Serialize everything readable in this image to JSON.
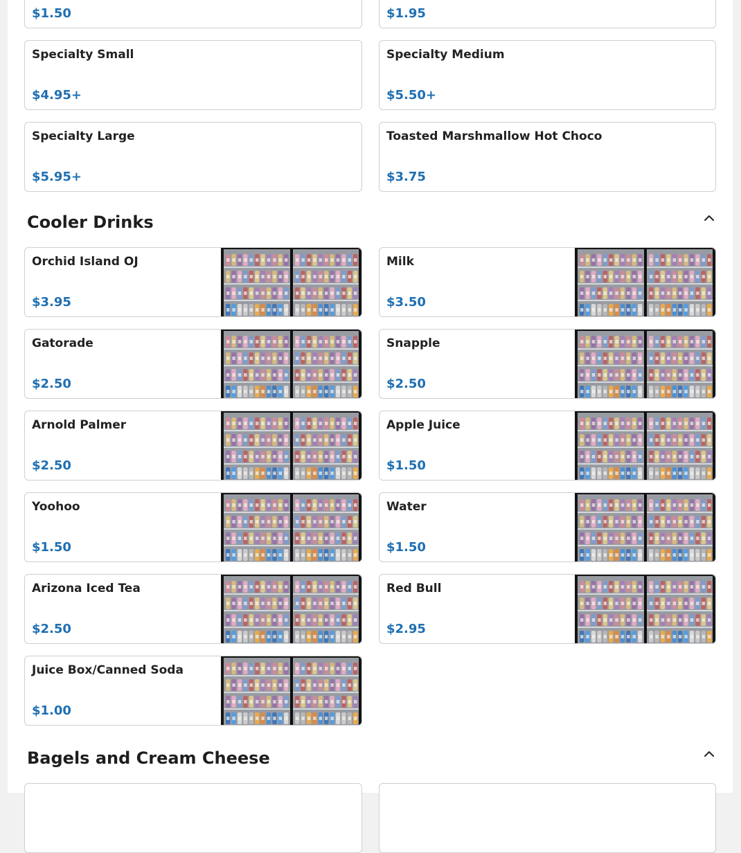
{
  "top_items": [
    {
      "name": "",
      "price": "$1.50"
    },
    {
      "name": "",
      "price": "$1.95"
    },
    {
      "name": "Specialty Small",
      "price": "$4.95+"
    },
    {
      "name": "Specialty Medium",
      "price": "$5.50+"
    },
    {
      "name": "Specialty Large",
      "price": "$5.95+"
    },
    {
      "name": "Toasted Marshmallow Hot Choco",
      "price": "$3.75"
    }
  ],
  "cooler": {
    "title": "Cooler Drinks",
    "items": [
      {
        "name": "Orchid Island OJ",
        "price": "$3.95"
      },
      {
        "name": "Milk",
        "price": "$3.50"
      },
      {
        "name": "Gatorade",
        "price": "$2.50"
      },
      {
        "name": "Snapple",
        "price": "$2.50"
      },
      {
        "name": "Arnold Palmer",
        "price": "$2.50"
      },
      {
        "name": "Apple Juice",
        "price": "$1.50"
      },
      {
        "name": "Yoohoo",
        "price": "$1.50"
      },
      {
        "name": "Water",
        "price": "$1.50"
      },
      {
        "name": "Arizona Iced Tea",
        "price": "$2.50"
      },
      {
        "name": "Red Bull",
        "price": "$2.95"
      },
      {
        "name": "Juice Box/Canned Soda",
        "price": "$1.00"
      }
    ]
  },
  "bagels": {
    "title": "Bagels and Cream Cheese"
  },
  "icons": {
    "section_toggle": "chevron-up-icon",
    "thumbnail": "drink-cooler-photo"
  },
  "colors": {
    "price": "#1f6fb2",
    "border": "#cfcfcf"
  }
}
